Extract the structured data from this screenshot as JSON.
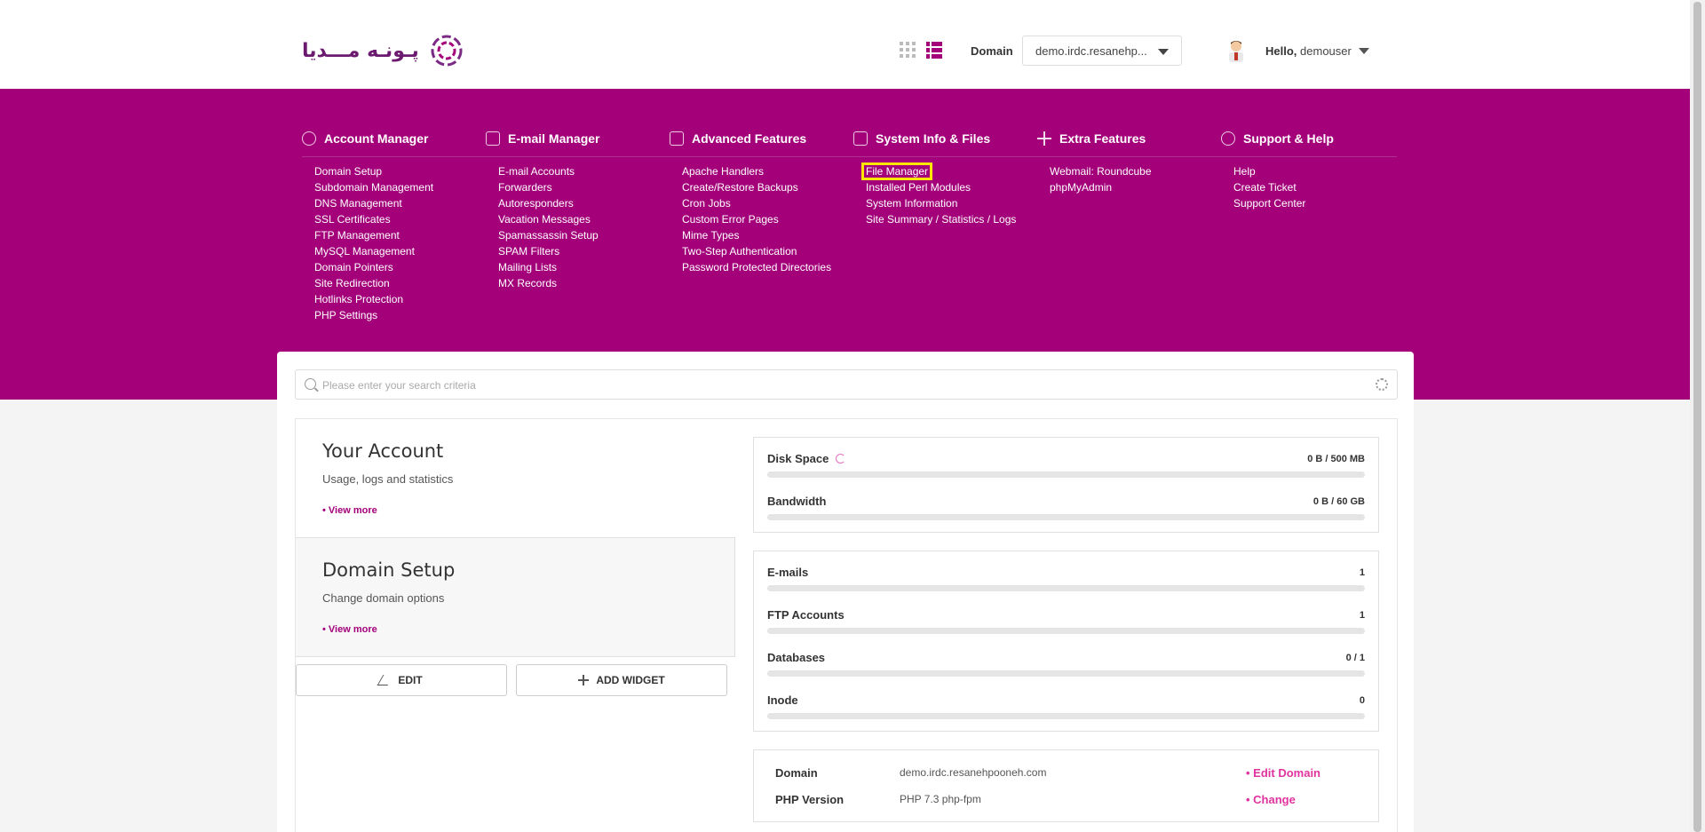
{
  "header": {
    "logo_text": "پـونـه مـــديا",
    "domain_label": "Domain",
    "domain_value": "demo.irdc.resanehp...",
    "hello_prefix": "Hello,",
    "username": "demouser"
  },
  "colors": {
    "brand": "#a3007a",
    "highlight": "#ffe600",
    "link_accent": "#e0339e"
  },
  "menu": [
    {
      "title": "Account Manager",
      "icon": "user-gear-icon",
      "items": [
        "Domain Setup",
        "Subdomain Management",
        "DNS Management",
        "SSL Certificates",
        "FTP Management",
        "MySQL Management",
        "Domain Pointers",
        "Site Redirection",
        "Hotlinks Protection",
        "PHP Settings"
      ]
    },
    {
      "title": "E-mail Manager",
      "icon": "paper-plane-icon",
      "items": [
        "E-mail Accounts",
        "Forwarders",
        "Autoresponders",
        "Vacation Messages",
        "Spamassassin Setup",
        "SPAM Filters",
        "Mailing Lists",
        "MX Records"
      ]
    },
    {
      "title": "Advanced Features",
      "icon": "table-icon",
      "items": [
        "Apache Handlers",
        "Create/Restore Backups",
        "Cron Jobs",
        "Custom Error Pages",
        "Mime Types",
        "Two-Step Authentication",
        "Password Protected Directories"
      ]
    },
    {
      "title": "System Info & Files",
      "icon": "folder-icon",
      "items": [
        "File Manager",
        "Installed Perl Modules",
        "System Information",
        "Site Summary / Statistics / Logs"
      ]
    },
    {
      "title": "Extra Features",
      "icon": "plus-icon",
      "items": [
        "Webmail: Roundcube",
        "phpMyAdmin"
      ]
    },
    {
      "title": "Support & Help",
      "icon": "lifebuoy-icon",
      "items": [
        "Help",
        "Create Ticket",
        "Support Center"
      ]
    }
  ],
  "search": {
    "placeholder": "Please enter your search criteria"
  },
  "widgets": [
    {
      "title": "Your Account",
      "subtitle": "Usage, logs and statistics",
      "more": "• View more"
    },
    {
      "title": "Domain Setup",
      "subtitle": "Change domain options",
      "more": "• View more"
    }
  ],
  "buttons": {
    "edit": "EDIT",
    "add_widget": "ADD WIDGET"
  },
  "usage": [
    {
      "name": "Disk Space",
      "value": "0 B / 500 MB",
      "fraction": 0
    },
    {
      "name": "Bandwidth",
      "value": "0 B / 60 GB",
      "fraction": 0
    }
  ],
  "counts": [
    {
      "name": "E-mails",
      "value": "1",
      "fraction": 0
    },
    {
      "name": "FTP Accounts",
      "value": "1",
      "fraction": 0
    },
    {
      "name": "Databases",
      "value": "0 / 1",
      "fraction": 0
    },
    {
      "name": "Inode",
      "value": "0",
      "fraction": 0
    }
  ],
  "info": [
    {
      "key": "Domain",
      "value": "demo.irdc.resanehpooneh.com",
      "action": "• Edit Domain"
    },
    {
      "key": "PHP Version",
      "value": "PHP 7.3 php-fpm",
      "action": "• Change"
    }
  ]
}
